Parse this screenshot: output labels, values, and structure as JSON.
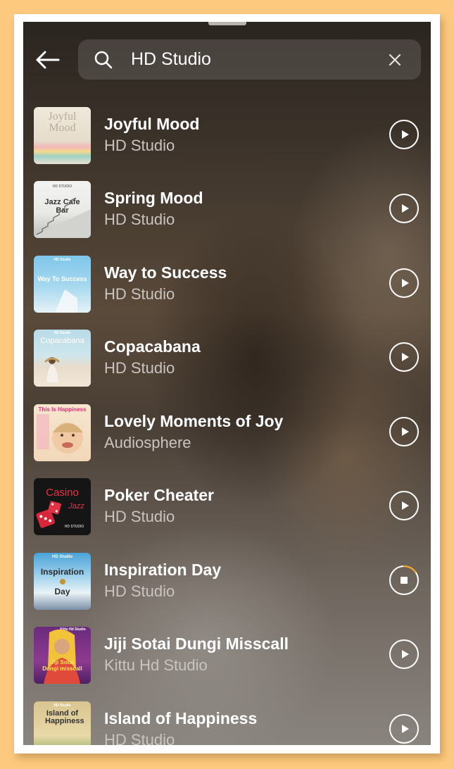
{
  "search": {
    "query": "HD Studio",
    "back_icon": "arrow-left-icon",
    "search_icon": "search-icon",
    "clear_icon": "close-icon"
  },
  "colors": {
    "page_background": "#fdc97f",
    "frame": "#ffffff",
    "text_primary": "#ffffff",
    "text_secondary": "#c9c4bf",
    "progress_accent": "#f5a623"
  },
  "tracks": [
    {
      "title": "Joyful Mood",
      "artist": "HD Studio",
      "cover_text": "Joyful Mood",
      "state": "play"
    },
    {
      "title": "Spring Mood",
      "artist": "HD Studio",
      "cover_text": "Jazz Cafe Bar",
      "cover_tag": "HD STUDIO",
      "state": "play"
    },
    {
      "title": "Way to Success",
      "artist": "HD Studio",
      "cover_text": "Way To Success",
      "cover_tag": "HD Studio",
      "state": "play"
    },
    {
      "title": "Copacabana",
      "artist": "HD Studio",
      "cover_text": "Copacabana",
      "cover_tag": "HD Studio",
      "state": "play"
    },
    {
      "title": "Lovely Moments of Joy",
      "artist": "Audiosphere",
      "cover_text": "This Is Happiness",
      "state": "play"
    },
    {
      "title": "Poker Cheater",
      "artist": "HD Studio",
      "cover_text": "Casino",
      "cover_text2": "Jazz",
      "cover_tag": "HD STUDIO",
      "state": "play"
    },
    {
      "title": "Inspiration Day",
      "artist": "HD Studio",
      "cover_text": "Inspiration",
      "cover_text2": "Day",
      "cover_tag": "HD Studio",
      "state": "playing",
      "progress": 0.15
    },
    {
      "title": "Jiji Sotai Dungi Misscall",
      "artist": "Kittu Hd Studio",
      "cover_text": "Jiji Sotai Dungi misscall",
      "cover_tag": "Kittu Hd Studio",
      "state": "play"
    },
    {
      "title": "Island of Happiness",
      "artist": "HD Studio",
      "cover_text": "Island of Happiness",
      "cover_tag": "HD Studio",
      "state": "play"
    }
  ]
}
